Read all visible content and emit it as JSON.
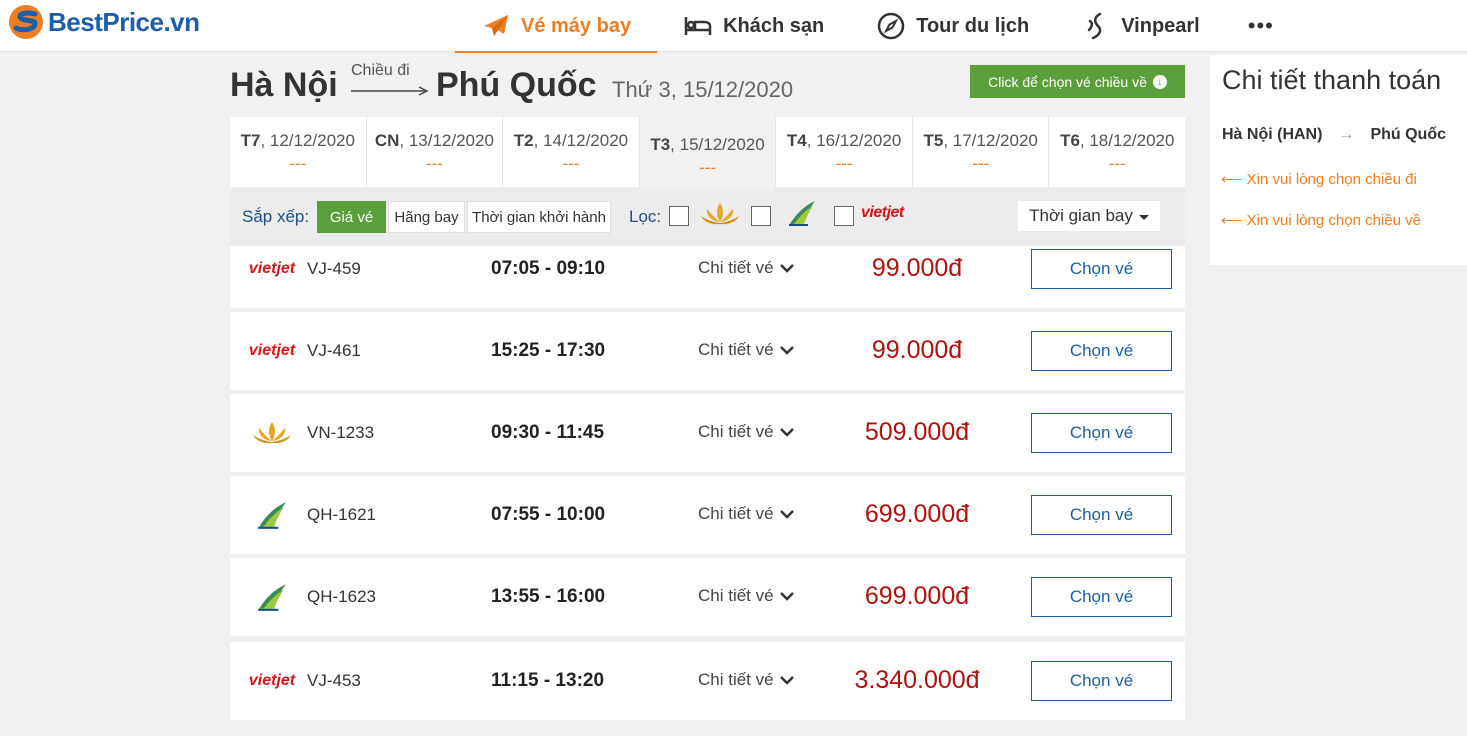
{
  "brand": {
    "name": "BestPrice.vn"
  },
  "nav": {
    "items": [
      {
        "label": "Vé máy bay",
        "icon": "plane-icon",
        "active": true
      },
      {
        "label": "Khách sạn",
        "icon": "bed-icon",
        "active": false
      },
      {
        "label": "Tour du lịch",
        "icon": "compass-icon",
        "active": false
      },
      {
        "label": "Vinpearl",
        "icon": "vinpearl-icon",
        "active": false
      }
    ],
    "more": "•••"
  },
  "route": {
    "from": "Hà Nội",
    "direction_label": "Chiều đi",
    "to": "Phú Quốc",
    "date": "Thứ 3, 15/12/2020",
    "return_button": "Click để chọn vé chiều về"
  },
  "date_tabs": [
    {
      "day": "T7",
      "date": ", 12/12/2020",
      "price": "---",
      "active": false
    },
    {
      "day": "CN",
      "date": ", 13/12/2020",
      "price": "---",
      "active": false
    },
    {
      "day": "T2",
      "date": ", 14/12/2020",
      "price": "---",
      "active": false
    },
    {
      "day": "T3",
      "date": ", 15/12/2020",
      "price": "---",
      "active": true
    },
    {
      "day": "T4",
      "date": ", 16/12/2020",
      "price": "---",
      "active": false
    },
    {
      "day": "T5",
      "date": ", 17/12/2020",
      "price": "---",
      "active": false
    },
    {
      "day": "T6",
      "date": ", 18/12/2020",
      "price": "---",
      "active": false
    }
  ],
  "filters": {
    "sort_label": "Sắp xếp:",
    "sort_options": [
      "Giá vé",
      "Hãng bay",
      "Thời gian khởi hành"
    ],
    "filter_label": "Lọc:",
    "vietjet_logo_text": "vietjet",
    "duration_label": "Thời gian bay"
  },
  "flights": [
    {
      "airline": "vietjet",
      "code": "VJ-459",
      "time": "07:05 - 09:10",
      "detail": "Chi tiết vé",
      "price": "99.000đ",
      "button": "Chọn vé"
    },
    {
      "airline": "vietjet",
      "code": "VJ-461",
      "time": "15:25 - 17:30",
      "detail": "Chi tiết vé",
      "price": "99.000đ",
      "button": "Chọn vé"
    },
    {
      "airline": "vietnam-airlines",
      "code": "VN-1233",
      "time": "09:30 - 11:45",
      "detail": "Chi tiết vé",
      "price": "509.000đ",
      "button": "Chọn vé"
    },
    {
      "airline": "bamboo",
      "code": "QH-1621",
      "time": "07:55 - 10:00",
      "detail": "Chi tiết vé",
      "price": "699.000đ",
      "button": "Chọn vé"
    },
    {
      "airline": "bamboo",
      "code": "QH-1623",
      "time": "13:55 - 16:00",
      "detail": "Chi tiết vé",
      "price": "699.000đ",
      "button": "Chọn vé"
    },
    {
      "airline": "vietjet",
      "code": "VJ-453",
      "time": "11:15 - 13:20",
      "detail": "Chi tiết vé",
      "price": "3.340.000đ",
      "button": "Chọn vé"
    }
  ],
  "payment": {
    "title": "Chi tiết thanh toán",
    "from": "Hà Nội (HAN)",
    "arrow": "→",
    "to": "Phú Quốc",
    "notice_outbound": "⟵ Xin vui lòng chọn chiều đi",
    "notice_return": "⟵ Xin vui lòng chọn chiều về"
  },
  "colors": {
    "accent": "#ef7e23",
    "brand_blue": "#1c5ea8",
    "green": "#5b9f3a",
    "price_red": "#b0120e"
  }
}
